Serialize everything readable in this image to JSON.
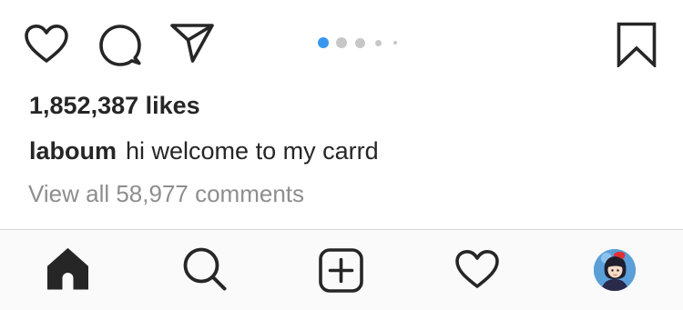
{
  "post": {
    "likes_text": "1,852,387 likes",
    "caption": {
      "username": "laboum",
      "text": "hi welcome to my carrd"
    },
    "view_comments_text": "View all 58,977 comments"
  },
  "actions": {
    "icons": [
      "heart-icon",
      "comment-icon",
      "share-icon",
      "bookmark-icon"
    ]
  },
  "carousel": {
    "dot_count": 5,
    "active_index": 0,
    "active_color": "#3897f0",
    "inactive_color": "#c7c7c7"
  },
  "tab_bar": {
    "items": [
      "home-icon",
      "search-icon",
      "new-post-icon",
      "activity-icon",
      "profile-avatar"
    ],
    "active_item": "home-icon"
  },
  "colors": {
    "text": "#262626",
    "secondary_text": "#8e8e8e",
    "tab_bar_background": "#fafafa",
    "divider": "#d5d5d5"
  }
}
